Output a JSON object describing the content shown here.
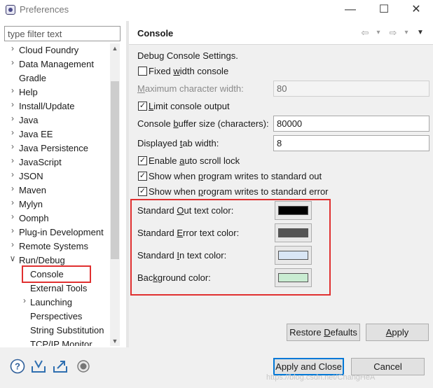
{
  "window": {
    "title": "Preferences",
    "minimize_glyph": "—",
    "maximize_glyph": "☐",
    "close_glyph": "✕"
  },
  "filter": {
    "placeholder": "type filter text"
  },
  "tree": {
    "items": [
      {
        "label": "Cloud Foundry",
        "arrow": "›"
      },
      {
        "label": "Data Management",
        "arrow": "›"
      },
      {
        "label": "Gradle",
        "arrow": ""
      },
      {
        "label": "Help",
        "arrow": "›"
      },
      {
        "label": "Install/Update",
        "arrow": "›"
      },
      {
        "label": "Java",
        "arrow": "›"
      },
      {
        "label": "Java EE",
        "arrow": "›"
      },
      {
        "label": "Java Persistence",
        "arrow": "›"
      },
      {
        "label": "JavaScript",
        "arrow": "›"
      },
      {
        "label": "JSON",
        "arrow": "›"
      },
      {
        "label": "Maven",
        "arrow": "›"
      },
      {
        "label": "Mylyn",
        "arrow": "›"
      },
      {
        "label": "Oomph",
        "arrow": "›"
      },
      {
        "label": "Plug-in Development",
        "arrow": "›"
      },
      {
        "label": "Remote Systems",
        "arrow": "›"
      },
      {
        "label": "Run/Debug",
        "arrow": "∨"
      },
      {
        "label": "Console",
        "arrow": ""
      },
      {
        "label": "External Tools",
        "arrow": ""
      },
      {
        "label": "Launching",
        "arrow": "›"
      },
      {
        "label": "Perspectives",
        "arrow": ""
      },
      {
        "label": "String Substitution",
        "arrow": ""
      },
      {
        "label": "TCP/IP Monitor",
        "arrow": ""
      }
    ],
    "selected": "Console"
  },
  "page": {
    "title": "Console",
    "nav_back": "⇦",
    "nav_forward": "⇨",
    "nav_drop": "▾",
    "menu": "▼",
    "section": "Debug Console Settings.",
    "fixed_width": {
      "pre": "Fixed ",
      "u": "w",
      "post": "idth console",
      "checked": false
    },
    "max_width": {
      "pre": "",
      "u": "M",
      "post": "aximum character width:",
      "value": "80"
    },
    "limit_output": {
      "pre": "",
      "u": "L",
      "post": "imit console output",
      "checked": true,
      "mark": "✓"
    },
    "buffer_size": {
      "pre": "Console ",
      "u": "b",
      "post": "uffer size (characters):",
      "value": "80000"
    },
    "tab_width": {
      "pre": "Displayed ",
      "u": "t",
      "post": "ab width:",
      "value": "8"
    },
    "auto_scroll": {
      "pre": "Enable ",
      "u": "a",
      "post": "uto scroll lock",
      "checked": true,
      "mark": "✓"
    },
    "show_out": {
      "pre": "Show when ",
      "u": "p",
      "post": "rogram writes to standard out",
      "checked": true,
      "mark": "✓"
    },
    "show_err": {
      "pre": "Show when ",
      "u": "p",
      "post": "rogram writes to standard error",
      "checked": true,
      "mark": "✓"
    },
    "colors": [
      {
        "pre": "Standard ",
        "u": "O",
        "post": "ut text color:",
        "color": "#000000"
      },
      {
        "pre": "Standard ",
        "u": "E",
        "post": "rror text color:",
        "color": "#555555"
      },
      {
        "pre": "Standard ",
        "u": "I",
        "post": "n text color:",
        "color": "#d9e6f5"
      },
      {
        "pre": "Bac",
        "u": "k",
        "post": "ground color:",
        "color": "#c9ecd2"
      }
    ],
    "highlight_color": "#e03030",
    "restore_defaults": {
      "pre": "Restore ",
      "u": "D",
      "post": "efaults"
    },
    "apply": {
      "pre": "",
      "u": "A",
      "post": "pply"
    }
  },
  "footer": {
    "apply_close": "Apply and Close",
    "cancel": "Cancel",
    "watermark": "https://blog.csdn.net/ChangHeA"
  }
}
